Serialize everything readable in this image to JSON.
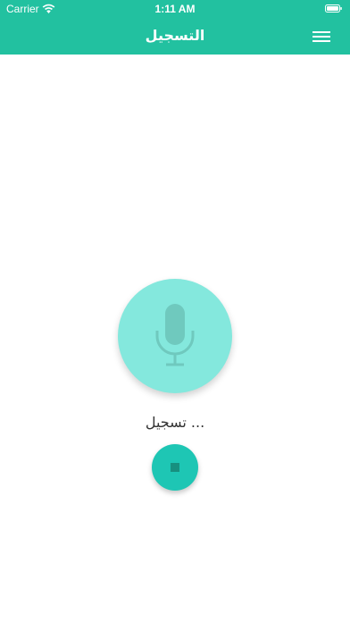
{
  "status_bar": {
    "carrier": "Carrier",
    "time": "1:11 AM",
    "wifi_icon": "wifi-icon",
    "battery_icon": "battery-icon"
  },
  "header": {
    "title": "التسجيل",
    "menu_icon": "hamburger-menu-icon",
    "background_color": "#22c1a0"
  },
  "recorder": {
    "mic_icon": "microphone-icon",
    "mic_circle_color": "#84e8dd",
    "status_text": "تسجيل ...",
    "stop_icon": "stop-icon",
    "stop_button_color": "#1ec6b4"
  }
}
